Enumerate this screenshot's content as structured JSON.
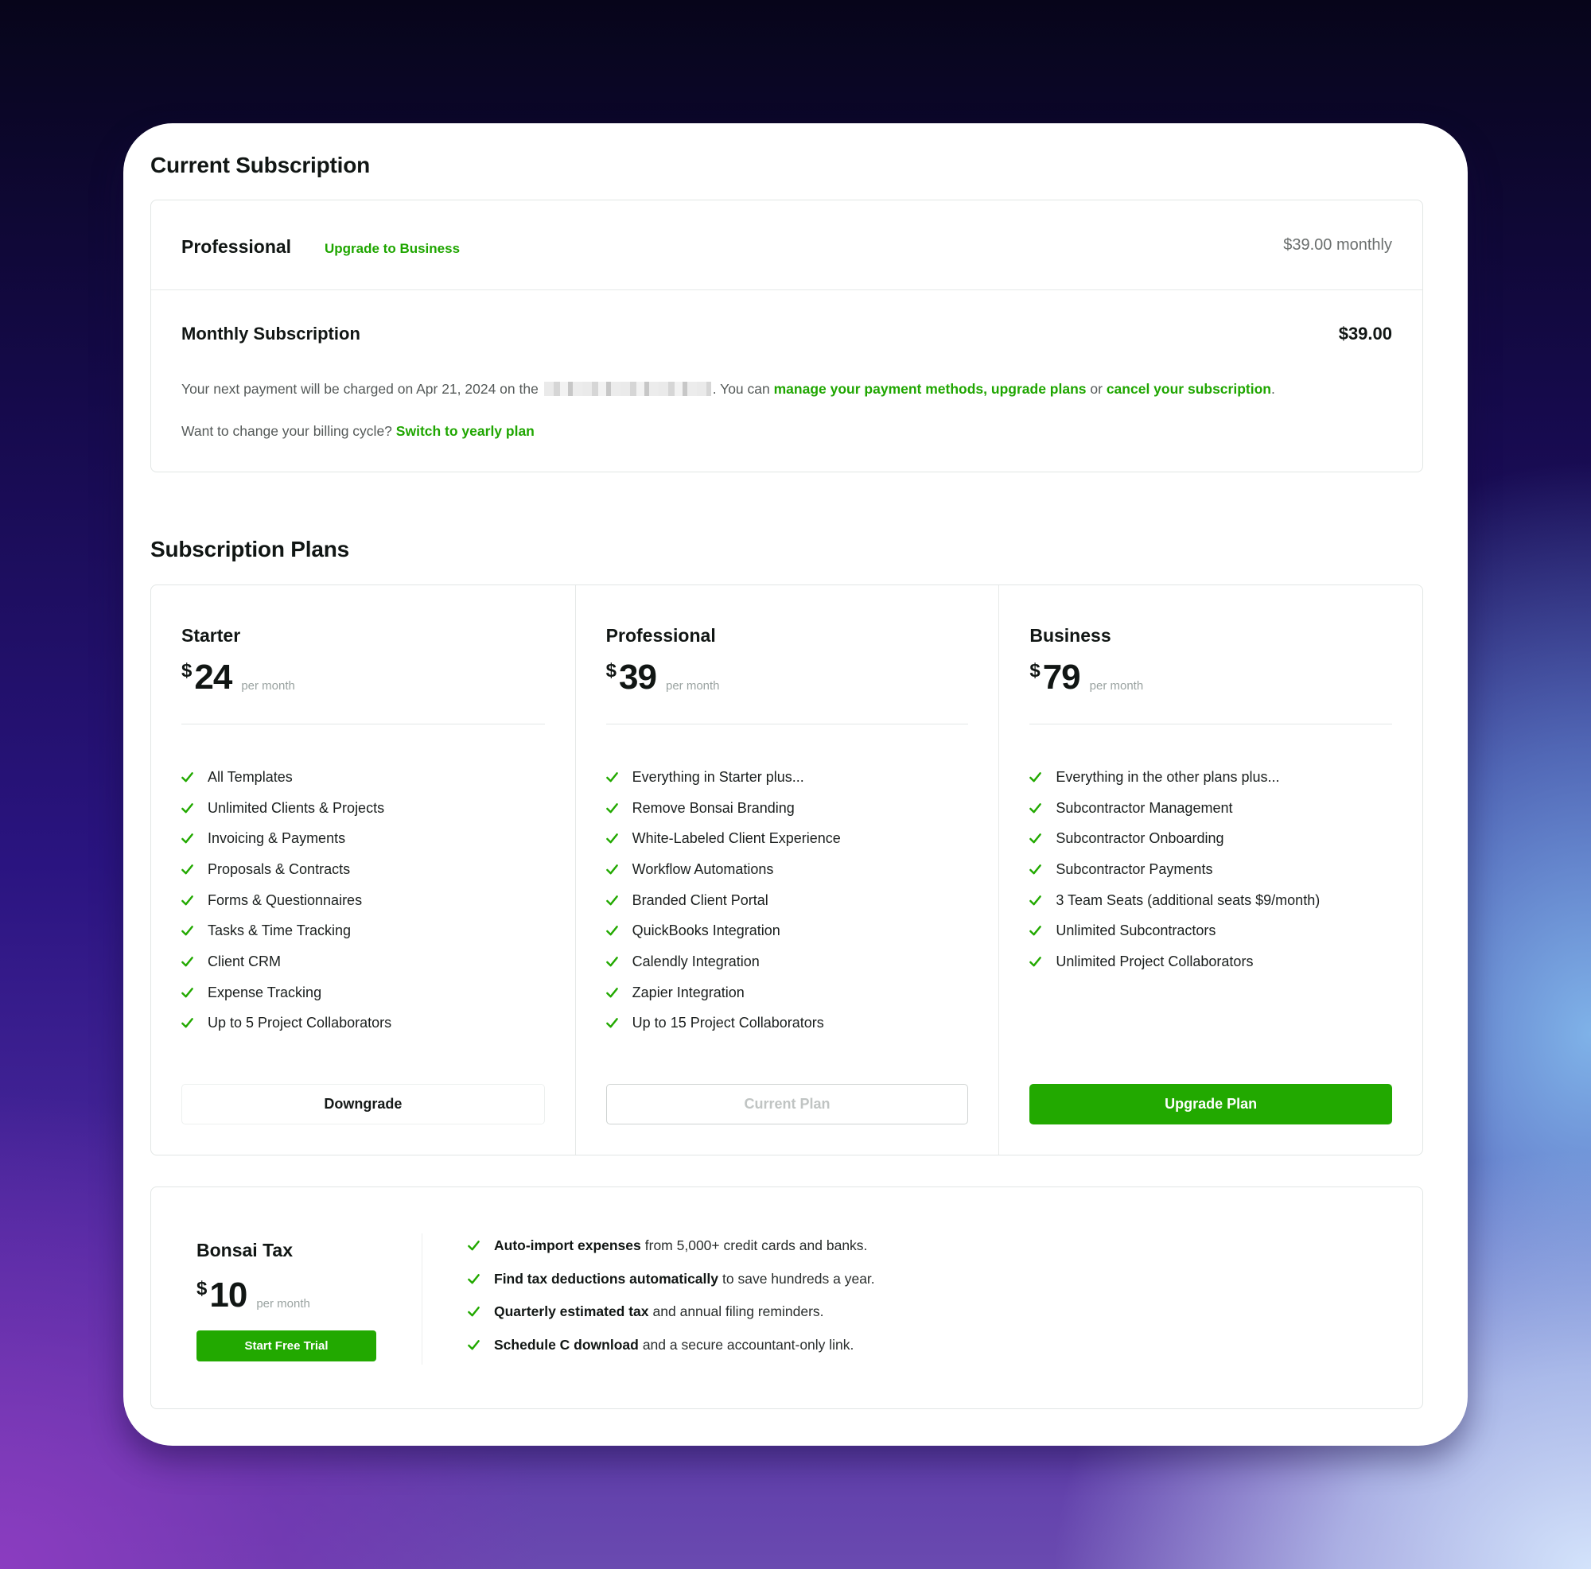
{
  "colors": {
    "accent_green": "#22a900",
    "link_green": "#1fa600",
    "text_dark": "#111614",
    "text_muted": "#6b6f6e"
  },
  "current_subscription": {
    "heading": "Current Subscription",
    "plan_name": "Professional",
    "upgrade_link": "Upgrade to Business",
    "plan_price": "$39.00 monthly",
    "billing_title": "Monthly Subscription",
    "billing_amount": "$39.00",
    "next_payment_prefix": "Your next payment will be charged on Apr 21, 2024 on the",
    "next_payment_mid": ". You can",
    "link_manage_payment": "manage your payment methods,",
    "link_upgrade_plans": "upgrade plans",
    "or_text": "or",
    "link_cancel": "cancel your subscription",
    "period": ".",
    "billing_cycle_prompt": "Want to change your billing cycle?",
    "link_switch_yearly": "Switch to yearly plan"
  },
  "subscription_plans": {
    "heading": "Subscription Plans",
    "plans": [
      {
        "name": "Starter",
        "currency": "$",
        "price": "24",
        "period": "per month",
        "features": [
          "All Templates",
          "Unlimited Clients & Projects",
          "Invoicing & Payments",
          "Proposals & Contracts",
          "Forms & Questionnaires",
          "Tasks & Time Tracking",
          "Client CRM",
          "Expense Tracking",
          "Up to 5 Project Collaborators"
        ],
        "button": "Downgrade"
      },
      {
        "name": "Professional",
        "currency": "$",
        "price": "39",
        "period": "per month",
        "features": [
          "Everything in Starter plus...",
          "Remove Bonsai Branding",
          "White-Labeled Client Experience",
          "Workflow Automations",
          "Branded Client Portal",
          "QuickBooks Integration",
          "Calendly Integration",
          "Zapier Integration",
          "Up to 15 Project Collaborators"
        ],
        "button": "Current Plan"
      },
      {
        "name": "Business",
        "currency": "$",
        "price": "79",
        "period": "per month",
        "features": [
          "Everything in the other plans plus...",
          "Subcontractor Management",
          "Subcontractor Onboarding",
          "Subcontractor Payments",
          "3 Team Seats (additional seats $9/month)",
          "Unlimited Subcontractors",
          "Unlimited Project Collaborators"
        ],
        "button": "Upgrade Plan"
      }
    ]
  },
  "bonsai_tax": {
    "name": "Bonsai Tax",
    "currency": "$",
    "price": "10",
    "period": "per month",
    "button": "Start Free Trial",
    "features": [
      {
        "bold": "Auto-import expenses",
        "rest": "from 5,000+ credit cards and banks."
      },
      {
        "bold": "Find tax deductions automatically",
        "rest": "to save hundreds a year."
      },
      {
        "bold": "Quarterly estimated tax",
        "rest": "and annual filing reminders."
      },
      {
        "bold": "Schedule C download",
        "rest": "and a secure accountant-only link."
      }
    ]
  }
}
